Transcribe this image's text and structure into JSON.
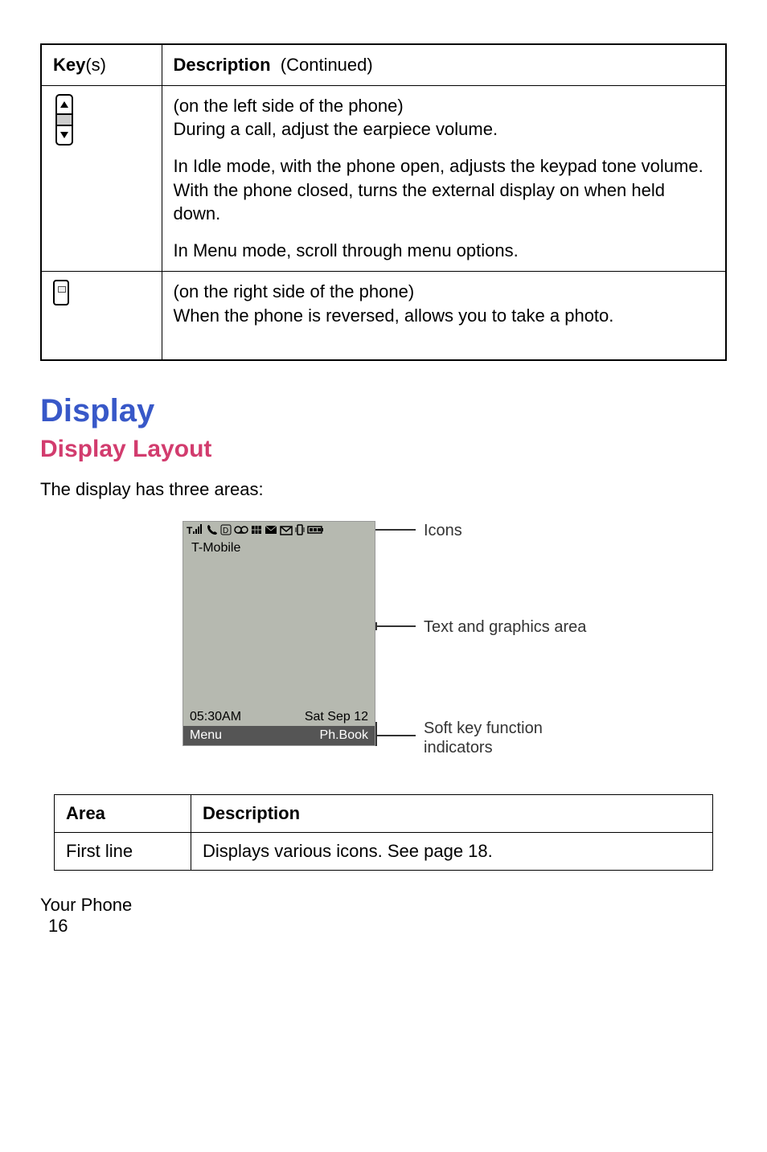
{
  "key_table": {
    "header": {
      "key": "Key",
      "key_suffix": "(s)",
      "desc": "Description",
      "desc_suffix": "(Continued)"
    },
    "rows": [
      {
        "para1": "(on the left side of the phone)",
        "para2": "During a call, adjust the earpiece volume.",
        "para3": "In Idle mode, with the phone open, adjusts the keypad tone volume. With the phone closed, turns the external display on when held down.",
        "para4": "In Menu mode, scroll through menu options."
      },
      {
        "para1": "(on the right side of the phone)",
        "para2": "When the phone is reversed, allows you to take a photo."
      }
    ]
  },
  "headings": {
    "display": "Display",
    "layout": "Display Layout"
  },
  "body": {
    "intro": "The display has three areas:"
  },
  "figure": {
    "carrier": "T-Mobile",
    "time": "05:30AM",
    "date": "Sat Sep 12",
    "soft_left": "Menu",
    "soft_right": "Ph.Book",
    "label_icons": "Icons",
    "label_text_area": "Text and graphics area",
    "label_softkey1": "Soft key function",
    "label_softkey2": "indicators"
  },
  "area_table": {
    "header_area": "Area",
    "header_desc": "Description",
    "row1_area": "First line",
    "row1_desc": "Displays various icons. See page 18."
  },
  "footer": {
    "chapter": "Your Phone",
    "page": "16"
  }
}
